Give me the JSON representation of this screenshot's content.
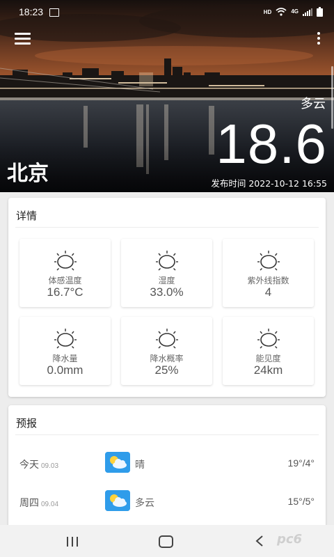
{
  "status_bar": {
    "time": "18:23",
    "hd": "HD",
    "network": "4G",
    "icons": [
      "image-icon",
      "wifi-icon",
      "signal-icon",
      "battery-icon"
    ]
  },
  "header": {
    "icons": [
      "menu-icon",
      "more-vertical-icon"
    ],
    "condition": "多云",
    "temperature": "18.6",
    "city": "北京",
    "publish_time": "发布时间 2022-10-12 16:55"
  },
  "details": {
    "title": "详情",
    "items": [
      {
        "label": "体感温度",
        "value": "16.7°C",
        "icon": "sun-icon"
      },
      {
        "label": "湿度",
        "value": "33.0%",
        "icon": "sun-icon"
      },
      {
        "label": "紫外线指数",
        "value": "4",
        "icon": "sun-icon"
      },
      {
        "label": "降水量",
        "value": "0.0mm",
        "icon": "sun-icon"
      },
      {
        "label": "降水概率",
        "value": "25%",
        "icon": "sun-icon"
      },
      {
        "label": "能见度",
        "value": "24km",
        "icon": "sun-icon"
      }
    ]
  },
  "forecast": {
    "title": "预报",
    "days": [
      {
        "day": "今天",
        "date": "09.03",
        "condition": "晴",
        "temp": "19°/4°",
        "icon": "partly-cloudy-icon"
      },
      {
        "day": "周四",
        "date": "09.04",
        "condition": "多云",
        "temp": "15°/5°",
        "icon": "partly-cloudy-icon"
      }
    ]
  },
  "nav_bar": {
    "icons": [
      "recent-apps-icon",
      "home-icon",
      "back-icon"
    ],
    "watermark": "pc6"
  },
  "colors": {
    "forecast_icon_bg": "#2f9cea",
    "sun_icon": "#333333"
  }
}
